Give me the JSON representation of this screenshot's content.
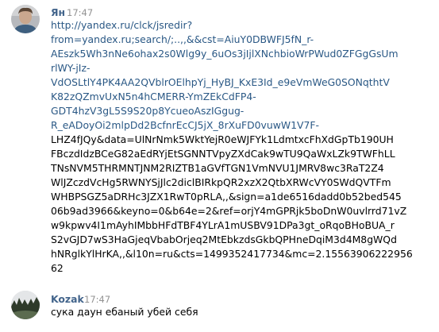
{
  "messages": [
    {
      "author": "Ян",
      "time": "17:47",
      "avatar_icon": "user-avatar-portrait",
      "link_lines": [
        "http://yandex.ru/clck/jsredir?",
        "from=yandex.ru;search/;..,,&&cst=AiuY0DBWFJ5fN_r-",
        "AEszk5Wh3nNe6ohax2s0Wlg9y_6uOs3jIjlXNchbioWrPWud0ZFGgGsUm",
        "rlWY-jIz-",
        "VdOSLtlY4PK4AA2QVblrOElhpYj_HyBJ_KxE3Id_e9eVmWeG0SONqthtV",
        "K82zQZmvUxN5n4hCMERR-YmZEkCdFP4-",
        "GDT4hzV3gL5S9S20p8YcueoAszIGgug-",
        "R_eADoyOi2mlpDd2BcfnrEcCJ5jX_8rXuFD0vuwW1V7F-"
      ],
      "text_lines": [
        "LHZ4fJQy&data=UlNrNmk5WktYejR0eWJFYk1LdmtxcFhXdGpTb190UH",
        "FBczdIdzBCeG82aEdRYjEtSGNNTVpyZXdCak9wTU9QaWxLZk9TWFhLL",
        "TNsNVM5THRMNTJNM2RIZTB1aGVfTGN1VmNVU1JMRV8wc3RaT2Z4",
        "WlJZczdVcHg5RWNYSjJlc2diclBIRkpQR2xzX2QtbXRWcVY0SWdQVTFm",
        "WHBPSGZ5aDRHc3JZX1RwT0pRLA,,&sign=a1de6516dadd0b52bed545",
        "06b9ad3966&keyno=0&b64e=2&ref=orjY4mGPRjk5boDnW0uvlrrd71vZ",
        "w9kpwv4I1mAyhIMbbHFdTBF4YLrA1mUSBV91DPa3gt_oRqoBHoBUA_r",
        "S2vGJD7wS3HaGjeqVbabOrjeq2MtEbkzdsGkbQPHneDqiM3d4M8gWQd",
        "hNRglkYlHrKA,,&l10n=ru&cts=1499352417734&mc=2.15563906222956",
        "62"
      ]
    },
    {
      "author": "Kozak",
      "time": "17:47",
      "avatar_icon": "landscape-avatar",
      "text_lines": [
        "сука даун ебаный убей себя"
      ]
    }
  ],
  "colors": {
    "author": "#42648b",
    "link": "#2a5885",
    "time": "#939393",
    "text": "#000000"
  }
}
